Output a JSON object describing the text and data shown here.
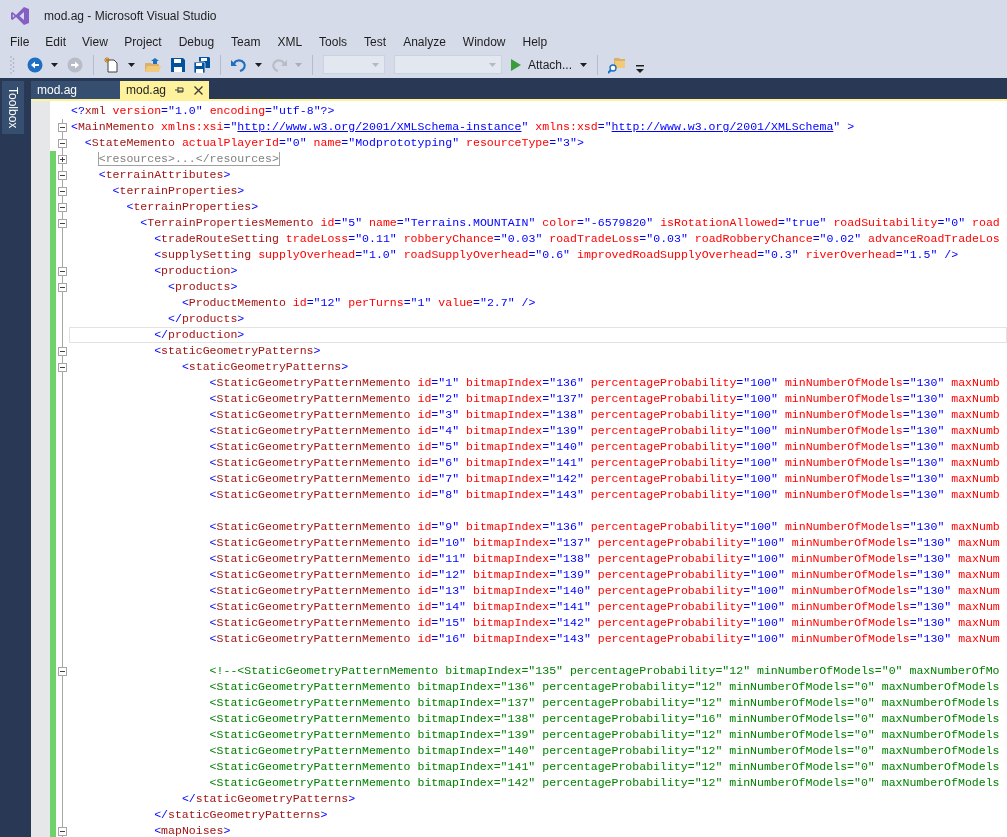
{
  "window": {
    "title": "mod.ag - Microsoft Visual Studio"
  },
  "menu": [
    "File",
    "Edit",
    "View",
    "Project",
    "Debug",
    "Team",
    "XML",
    "Tools",
    "Test",
    "Analyze",
    "Window",
    "Help"
  ],
  "toolbar": [
    {
      "kind": "back",
      "disabled": false,
      "dropdown": true
    },
    {
      "kind": "forward",
      "disabled": true
    },
    {
      "kind": "separator"
    },
    {
      "kind": "new-project",
      "dropdown": true
    },
    {
      "kind": "open"
    },
    {
      "kind": "save"
    },
    {
      "kind": "save-all"
    },
    {
      "kind": "separator"
    },
    {
      "kind": "undo",
      "disabled": false,
      "dropdown": true
    },
    {
      "kind": "redo",
      "disabled": true,
      "dropdown": true
    },
    {
      "kind": "separator"
    },
    {
      "kind": "config-combo",
      "disabled": true
    },
    {
      "kind": "platform-combo",
      "disabled": true
    },
    {
      "kind": "attach",
      "label": "Attach...",
      "disabled": false,
      "dropdown": true
    },
    {
      "kind": "separator"
    },
    {
      "kind": "find"
    }
  ],
  "side_panel": {
    "label": "Toolbox"
  },
  "tabs": [
    {
      "label": "mod.ag",
      "selected": false
    },
    {
      "label": "mod.ag",
      "selected": true
    }
  ],
  "lines": [
    {
      "segments": [
        {
          "kind": "code",
          "text": "<?xml version=\"1.0\" encoding=\"utf-8\"?>"
        }
      ],
      "changed": false,
      "selected": false
    },
    {
      "segments": [
        {
          "kind": "code",
          "text": "<MainMemento xmlns:xsi=\""
        },
        {
          "kind": "link",
          "text": "http://www.w3.org/2001/XMLSchema-instance"
        },
        {
          "kind": "code",
          "text": "\" xmlns:xsd=\""
        },
        {
          "kind": "link",
          "text": "http://www.w3.org/2001/XMLSchema"
        },
        {
          "kind": "code",
          "text": "\" >"
        }
      ],
      "expanded": true,
      "changed": false,
      "selected": false
    },
    {
      "segments": [
        {
          "kind": "code",
          "text": "  <StateMemento actualPlayerId=\"0\" name=\"Modprototyping\" resourceType=\"3\">"
        }
      ],
      "expanded": true,
      "changed": false,
      "selected": false
    },
    {
      "segments": [
        {
          "kind": "collapsed",
          "text": "    <resources>...</resources>"
        }
      ],
      "expanded": false,
      "changed": true,
      "selected": false
    },
    {
      "segments": [
        {
          "kind": "code",
          "text": "    <terrainAttributes>"
        }
      ],
      "expanded": true,
      "changed": true,
      "selected": false
    },
    {
      "segments": [
        {
          "kind": "code",
          "text": "      <terrainProperties>"
        }
      ],
      "expanded": true,
      "changed": true,
      "selected": false
    },
    {
      "segments": [
        {
          "kind": "code",
          "text": "        <terrainProperties>"
        }
      ],
      "expanded": true,
      "changed": true,
      "selected": false
    },
    {
      "segments": [
        {
          "kind": "code",
          "text": "          <TerrainPropertiesMemento id=\"5\" name=\"Terrains.MOUNTAIN\" color=\"-6579820\" isRotationAllowed=\"true\" roadSuitability=\"0\" road"
        }
      ],
      "expanded": true,
      "changed": true,
      "selected": false
    },
    {
      "segments": [
        {
          "kind": "code",
          "text": "            <tradeRouteSetting tradeLoss=\"0.11\" robberyChance=\"0.03\" roadTradeLoss=\"0.03\" roadRobberyChance=\"0.02\" advanceRoadTradeLos"
        }
      ],
      "changed": true,
      "selected": false
    },
    {
      "segments": [
        {
          "kind": "code",
          "text": "            <supplySetting supplyOverhead=\"1.0\" roadSupplyOverhead=\"0.6\" improvedRoadSupplyOverhead=\"0.3\" riverOverhead=\"1.5\" />"
        }
      ],
      "changed": true,
      "selected": false
    },
    {
      "segments": [
        {
          "kind": "code",
          "text": "            <production>"
        }
      ],
      "expanded": true,
      "changed": true,
      "selected": false
    },
    {
      "segments": [
        {
          "kind": "code",
          "text": "              <products>"
        }
      ],
      "expanded": true,
      "changed": true,
      "selected": false
    },
    {
      "segments": [
        {
          "kind": "code",
          "text": "                <ProductMemento id=\"12\" perTurns=\"1\" value=\"2.7\" />"
        }
      ],
      "changed": true,
      "selected": false
    },
    {
      "segments": [
        {
          "kind": "code",
          "text": "              </products>"
        }
      ],
      "changed": true,
      "selected": false
    },
    {
      "segments": [
        {
          "kind": "code",
          "text": "            </production>"
        }
      ],
      "changed": true,
      "selected": true
    },
    {
      "segments": [
        {
          "kind": "code",
          "text": "            <staticGeometryPatterns>"
        }
      ],
      "expanded": true,
      "changed": true,
      "selected": false
    },
    {
      "segments": [
        {
          "kind": "code",
          "text": "                <staticGeometryPatterns>"
        }
      ],
      "expanded": true,
      "changed": true,
      "selected": false
    },
    {
      "segments": [
        {
          "kind": "code",
          "text": "                    <StaticGeometryPatternMemento id=\"1\" bitmapIndex=\"136\" percentageProbability=\"100\" minNumberOfModels=\"130\" maxNumb"
        }
      ],
      "changed": true,
      "selected": false
    },
    {
      "segments": [
        {
          "kind": "code",
          "text": "                    <StaticGeometryPatternMemento id=\"2\" bitmapIndex=\"137\" percentageProbability=\"100\" minNumberOfModels=\"130\" maxNumb"
        }
      ],
      "changed": true,
      "selected": false
    },
    {
      "segments": [
        {
          "kind": "code",
          "text": "                    <StaticGeometryPatternMemento id=\"3\" bitmapIndex=\"138\" percentageProbability=\"100\" minNumberOfModels=\"130\" maxNumb"
        }
      ],
      "changed": true,
      "selected": false
    },
    {
      "segments": [
        {
          "kind": "code",
          "text": "                    <StaticGeometryPatternMemento id=\"4\" bitmapIndex=\"139\" percentageProbability=\"100\" minNumberOfModels=\"130\" maxNumb"
        }
      ],
      "changed": true,
      "selected": false
    },
    {
      "segments": [
        {
          "kind": "code",
          "text": "                    <StaticGeometryPatternMemento id=\"5\" bitmapIndex=\"140\" percentageProbability=\"100\" minNumberOfModels=\"130\" maxNumb"
        }
      ],
      "changed": true,
      "selected": false
    },
    {
      "segments": [
        {
          "kind": "code",
          "text": "                    <StaticGeometryPatternMemento id=\"6\" bitmapIndex=\"141\" percentageProbability=\"100\" minNumberOfModels=\"130\" maxNumb"
        }
      ],
      "changed": true,
      "selected": false
    },
    {
      "segments": [
        {
          "kind": "code",
          "text": "                    <StaticGeometryPatternMemento id=\"7\" bitmapIndex=\"142\" percentageProbability=\"100\" minNumberOfModels=\"130\" maxNumb"
        }
      ],
      "changed": true,
      "selected": false
    },
    {
      "segments": [
        {
          "kind": "code",
          "text": "                    <StaticGeometryPatternMemento id=\"8\" bitmapIndex=\"143\" percentageProbability=\"100\" minNumberOfModels=\"130\" maxNumb"
        }
      ],
      "changed": true,
      "selected": false
    },
    {
      "changed": true,
      "selected": false
    },
    {
      "segments": [
        {
          "kind": "code",
          "text": "                    <StaticGeometryPatternMemento id=\"9\" bitmapIndex=\"136\" percentageProbability=\"100\" minNumberOfModels=\"130\" maxNumb"
        }
      ],
      "changed": true,
      "selected": false
    },
    {
      "segments": [
        {
          "kind": "code",
          "text": "                    <StaticGeometryPatternMemento id=\"10\" bitmapIndex=\"137\" percentageProbability=\"100\" minNumberOfModels=\"130\" maxNum"
        }
      ],
      "changed": true,
      "selected": false
    },
    {
      "segments": [
        {
          "kind": "code",
          "text": "                    <StaticGeometryPatternMemento id=\"11\" bitmapIndex=\"138\" percentageProbability=\"100\" minNumberOfModels=\"130\" maxNum"
        }
      ],
      "changed": true,
      "selected": false
    },
    {
      "segments": [
        {
          "kind": "code",
          "text": "                    <StaticGeometryPatternMemento id=\"12\" bitmapIndex=\"139\" percentageProbability=\"100\" minNumberOfModels=\"130\" maxNum"
        }
      ],
      "changed": true,
      "selected": false
    },
    {
      "segments": [
        {
          "kind": "code",
          "text": "                    <StaticGeometryPatternMemento id=\"13\" bitmapIndex=\"140\" percentageProbability=\"100\" minNumberOfModels=\"130\" maxNum"
        }
      ],
      "changed": true,
      "selected": false
    },
    {
      "segments": [
        {
          "kind": "code",
          "text": "                    <StaticGeometryPatternMemento id=\"14\" bitmapIndex=\"141\" percentageProbability=\"100\" minNumberOfModels=\"130\" maxNum"
        }
      ],
      "changed": true,
      "selected": false
    },
    {
      "segments": [
        {
          "kind": "code",
          "text": "                    <StaticGeometryPatternMemento id=\"15\" bitmapIndex=\"142\" percentageProbability=\"100\" minNumberOfModels=\"130\" maxNum"
        }
      ],
      "changed": true,
      "selected": false
    },
    {
      "segments": [
        {
          "kind": "code",
          "text": "                    <StaticGeometryPatternMemento id=\"16\" bitmapIndex=\"143\" percentageProbability=\"100\" minNumberOfModels=\"130\" maxNum"
        }
      ],
      "changed": true,
      "selected": false
    },
    {
      "changed": true,
      "selected": false
    },
    {
      "segments": [
        {
          "kind": "comment",
          "text": "                    <!--<StaticGeometryPatternMemento bitmapIndex=\"135\" percentageProbability=\"12\" minNumberOfModels=\"0\" maxNumberOfMo"
        }
      ],
      "expanded": true,
      "changed": true,
      "selected": false
    },
    {
      "segments": [
        {
          "kind": "comment",
          "text": "                    <StaticGeometryPatternMemento bitmapIndex=\"136\" percentageProbability=\"12\" minNumberOfModels=\"0\" maxNumberOfModels"
        }
      ],
      "changed": true,
      "selected": false
    },
    {
      "segments": [
        {
          "kind": "comment",
          "text": "                    <StaticGeometryPatternMemento bitmapIndex=\"137\" percentageProbability=\"12\" minNumberOfModels=\"0\" maxNumberOfModels"
        }
      ],
      "changed": true,
      "selected": false
    },
    {
      "segments": [
        {
          "kind": "comment",
          "text": "                    <StaticGeometryPatternMemento bitmapIndex=\"138\" percentageProbability=\"16\" minNumberOfModels=\"0\" maxNumberOfModels"
        }
      ],
      "changed": true,
      "selected": false
    },
    {
      "segments": [
        {
          "kind": "comment",
          "text": "                    <StaticGeometryPatternMemento bitmapIndex=\"139\" percentageProbability=\"12\" minNumberOfModels=\"0\" maxNumberOfModels"
        }
      ],
      "changed": true,
      "selected": false
    },
    {
      "segments": [
        {
          "kind": "comment",
          "text": "                    <StaticGeometryPatternMemento bitmapIndex=\"140\" percentageProbability=\"12\" minNumberOfModels=\"0\" maxNumberOfModels"
        }
      ],
      "changed": true,
      "selected": false
    },
    {
      "segments": [
        {
          "kind": "comment",
          "text": "                    <StaticGeometryPatternMemento bitmapIndex=\"141\" percentageProbability=\"12\" minNumberOfModels=\"0\" maxNumberOfModels"
        }
      ],
      "changed": true,
      "selected": false
    },
    {
      "segments": [
        {
          "kind": "comment",
          "text": "                    <StaticGeometryPatternMemento bitmapIndex=\"142\" percentageProbability=\"12\" minNumberOfModels=\"0\" maxNumberOfModels"
        }
      ],
      "changed": true,
      "selected": false
    },
    {
      "segments": [
        {
          "kind": "code",
          "text": "                </staticGeometryPatterns>"
        }
      ],
      "changed": true,
      "selected": false
    },
    {
      "segments": [
        {
          "kind": "code",
          "text": "            </staticGeometryPatterns>"
        }
      ],
      "changed": true,
      "selected": false
    },
    {
      "segments": [
        {
          "kind": "code",
          "text": "            <mapNoises>"
        }
      ],
      "expanded": true,
      "changed": true,
      "selected": false
    }
  ]
}
